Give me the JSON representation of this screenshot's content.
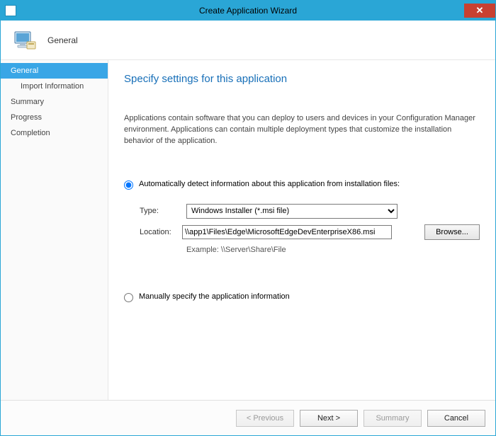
{
  "window": {
    "title": "Create Application Wizard",
    "close": "✕"
  },
  "header": {
    "title": "General"
  },
  "sidebar": {
    "items": [
      {
        "label": "General",
        "active": true
      },
      {
        "label": "Import Information",
        "sub": true
      },
      {
        "label": "Summary"
      },
      {
        "label": "Progress"
      },
      {
        "label": "Completion"
      }
    ]
  },
  "content": {
    "heading": "Specify settings for this application",
    "description": "Applications contain software that you can deploy to users and devices in your Configuration Manager environment. Applications can contain multiple deployment types that customize the installation behavior of the application.",
    "option_auto": "Automatically detect information about this application from installation files:",
    "option_manual": "Manually specify the application information",
    "type_label": "Type:",
    "type_value": "Windows Installer (*.msi file)",
    "location_label": "Location:",
    "location_value": "\\\\app1\\Files\\Edge\\MicrosoftEdgeDevEnterpriseX86.msi",
    "browse": "Browse...",
    "example": "Example: \\\\Server\\Share\\File"
  },
  "footer": {
    "previous": "< Previous",
    "next": "Next >",
    "summary": "Summary",
    "cancel": "Cancel"
  }
}
